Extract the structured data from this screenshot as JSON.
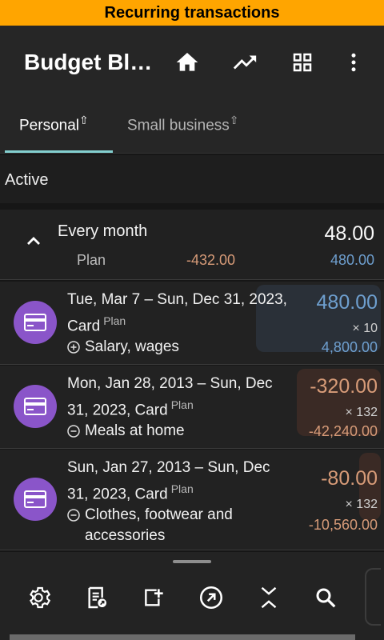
{
  "banner": {
    "text": "Recurring transactions"
  },
  "header": {
    "title": "Budget Bl…",
    "icons": [
      "home-icon",
      "trending-up-icon",
      "dashboard-icon",
      "more-vert-icon"
    ]
  },
  "tabs": [
    {
      "label": "Personal",
      "selected": true
    },
    {
      "label": "Small business",
      "selected": false
    }
  ],
  "section": {
    "label": "Active"
  },
  "group": {
    "title": "Every month",
    "amount": "48.00",
    "plan_label": "Plan",
    "plan_spent": "-432.00",
    "plan_total": "480.00"
  },
  "transactions": [
    {
      "icon": "card-icon",
      "line1": "Tue, Mar 7 – Sun, Dec 31, 2023,",
      "line2": "Card",
      "tag": "Plan",
      "category_sign": "plus",
      "category": "Salary, wages",
      "amount": "480.00",
      "multiplier": "× 10",
      "total": "4,800.00",
      "tone": "income",
      "fill": 1.0
    },
    {
      "icon": "card-icon",
      "line1": "Mon, Jan 28, 2013 – Sun, Dec",
      "line2": "31, 2023, Card",
      "tag": "Plan",
      "category_sign": "minus",
      "category": "Meals at home",
      "amount": "-320.00",
      "multiplier": "× 132",
      "total": "-42,240.00",
      "tone": "expense",
      "fill": 0.67
    },
    {
      "icon": "card-icon",
      "line1": "Sun, Jan 27, 2013 – Sun, Dec",
      "line2": "31, 2023, Card",
      "tag": "Plan",
      "category_sign": "minus",
      "category": "Clothes, footwear and accessories",
      "amount": "-80.00",
      "multiplier": "× 132",
      "total": "-10,560.00",
      "tone": "expense",
      "fill": 0.17
    }
  ],
  "toolbar": {
    "icons": [
      "settings-icon",
      "receipt-icon",
      "add-box-icon",
      "open-external-icon",
      "collapse-icon",
      "search-icon"
    ]
  },
  "colors": {
    "banner": "#ffa500",
    "accent": "#83cfcf",
    "income": "#6e9fcf",
    "expense": "#d79b78",
    "avatar": "#8a55c9"
  }
}
